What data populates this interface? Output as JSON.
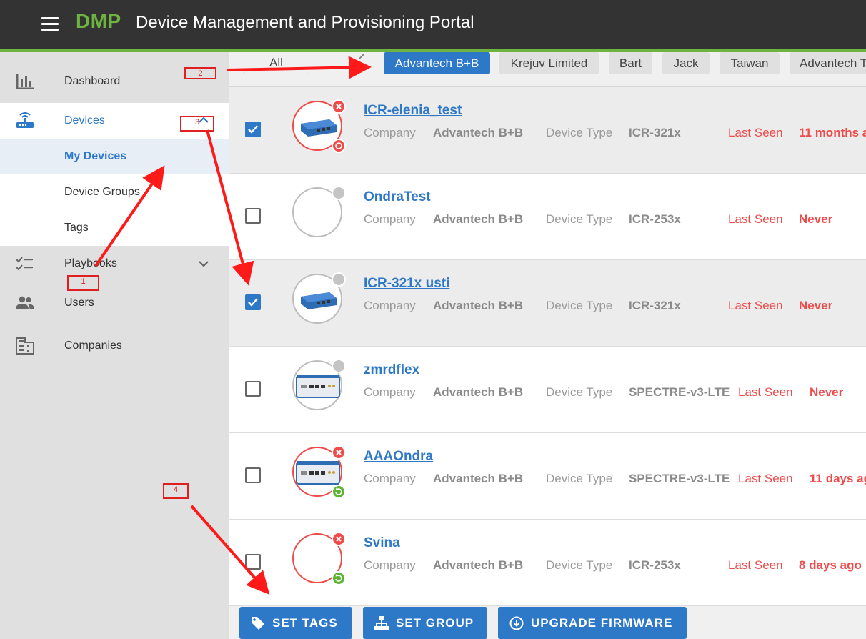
{
  "header": {
    "brand": "DMP",
    "title": "Device Management and Provisioning Portal"
  },
  "sidebar": {
    "items": [
      {
        "label": "Dashboard",
        "icon": "bar-chart-icon"
      },
      {
        "label": "Devices",
        "icon": "router-icon"
      },
      {
        "label": "Playbooks",
        "icon": "checklist-icon"
      },
      {
        "label": "Users",
        "icon": "users-icon"
      },
      {
        "label": "Companies",
        "icon": "building-icon"
      }
    ],
    "devices_submenu": [
      {
        "label": "My Devices"
      },
      {
        "label": "Device Groups"
      },
      {
        "label": "Tags"
      }
    ]
  },
  "filters": {
    "all_label": "All",
    "companies": [
      "Advantech B+B",
      "Krejuv Limited",
      "Bart",
      "Jack",
      "Taiwan",
      "Advantech T"
    ]
  },
  "labels": {
    "company": "Company",
    "device_type": "Device Type",
    "last_seen": "Last Seen"
  },
  "devices": [
    {
      "name": "ICR-elenia_test",
      "company": "Advantech B+B",
      "type": "ICR-321x",
      "last_seen": "11 months a",
      "checked": true
    },
    {
      "name": "OndraTest",
      "company": "Advantech B+B",
      "type": "ICR-253x",
      "last_seen": "Never",
      "checked": false
    },
    {
      "name": "ICR-321x usti",
      "company": "Advantech B+B",
      "type": "ICR-321x",
      "last_seen": "Never",
      "checked": true
    },
    {
      "name": "zmrdflex",
      "company": "Advantech B+B",
      "type": "SPECTRE-v3-LTE",
      "last_seen": "Never",
      "checked": false
    },
    {
      "name": "AAAOndra",
      "company": "Advantech B+B",
      "type": "SPECTRE-v3-LTE",
      "last_seen": "11 days ag",
      "checked": false
    },
    {
      "name": "Svina",
      "company": "Advantech B+B",
      "type": "ICR-253x",
      "last_seen": "8 days ago",
      "checked": false
    }
  ],
  "actions": {
    "set_tags": "SET TAGS",
    "set_group": "SET GROUP",
    "upgrade_firmware": "UPGRADE FIRMWARE"
  },
  "annotations": [
    "1",
    "2",
    "3",
    "4"
  ],
  "colors": {
    "header_bg": "#333333",
    "brand_green": "#6db33f",
    "primary_blue": "#2e78c8",
    "alert_red": "#f04b4b",
    "sync_green": "#5cb532",
    "annotation_red": "#e02020"
  }
}
